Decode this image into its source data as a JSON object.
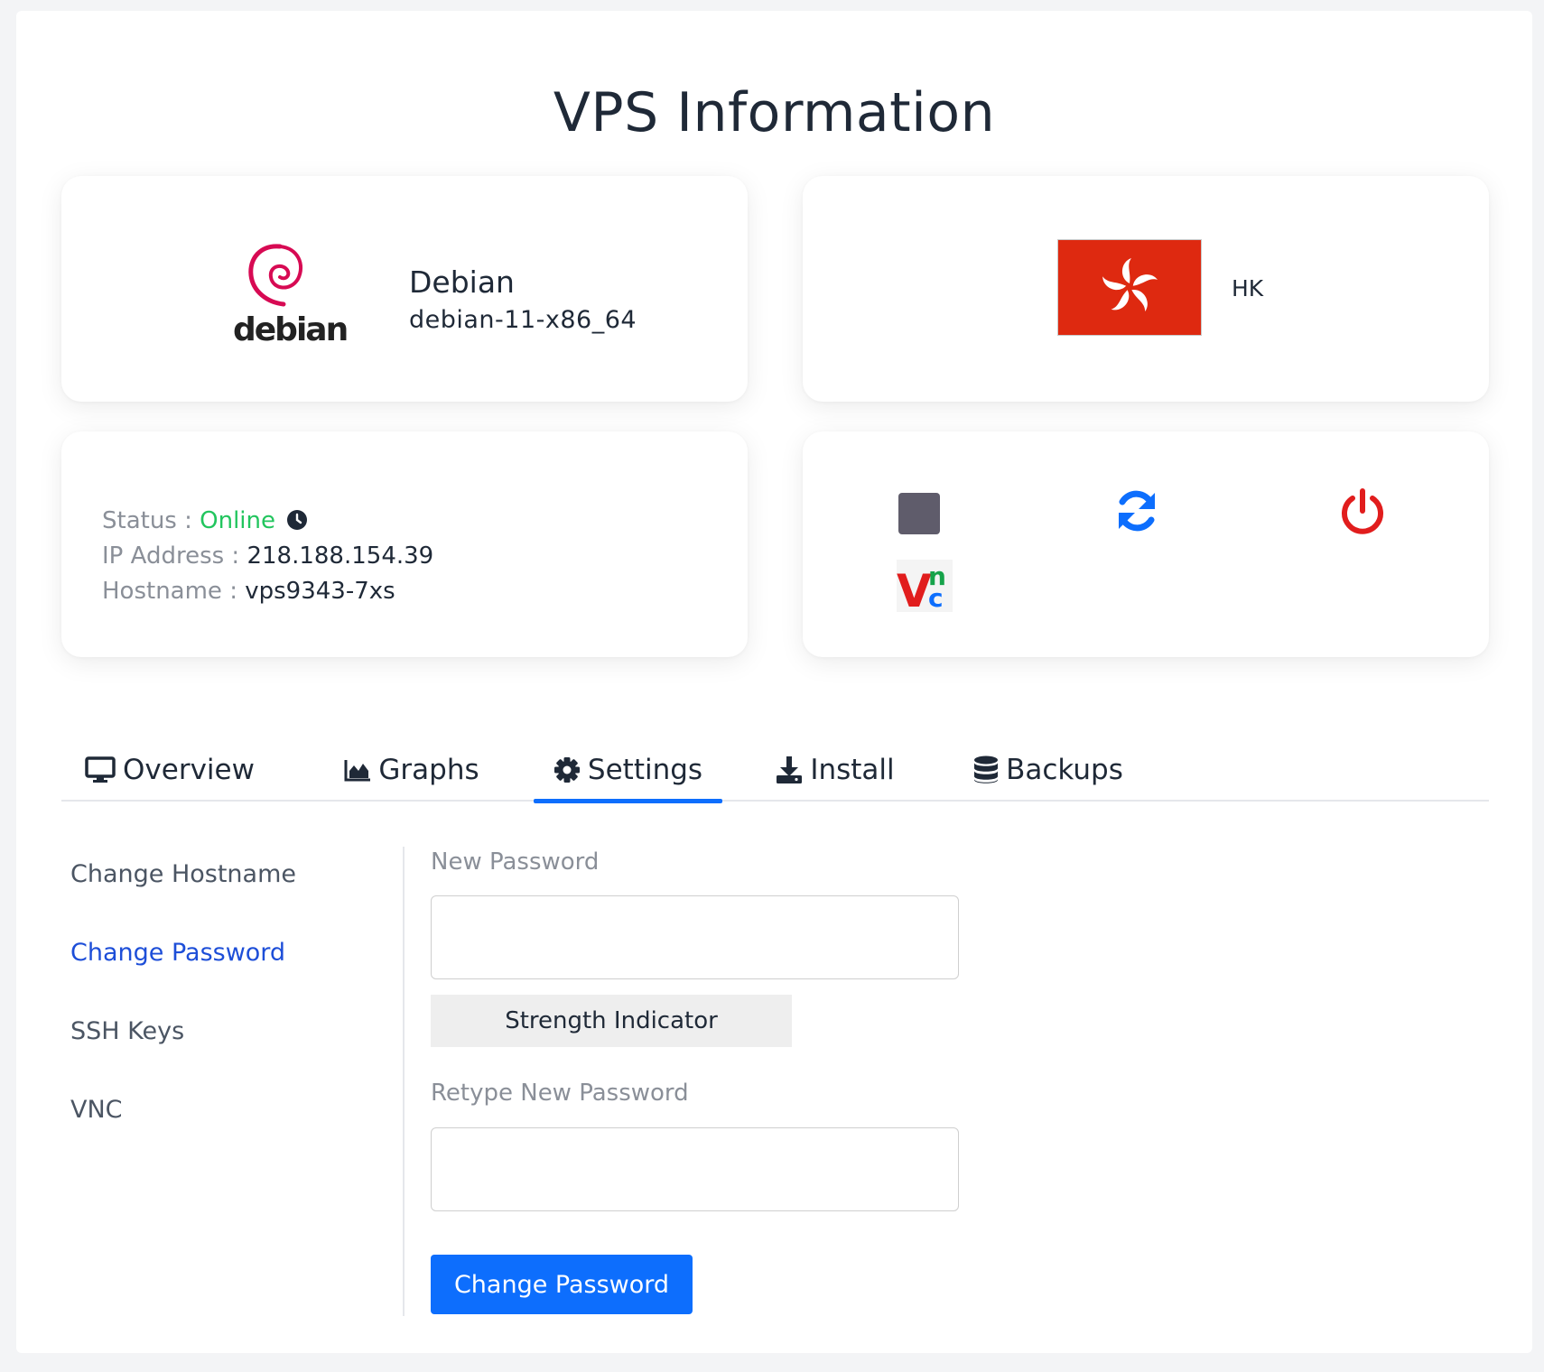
{
  "page": {
    "title": "VPS Information"
  },
  "os": {
    "logo_text": "debian",
    "name": "Debian",
    "version": "debian-11-x86_64",
    "icon": "debian-swirl-logo"
  },
  "location": {
    "code": "HK",
    "flag": "hong-kong-flag",
    "flag_color": "#de2910"
  },
  "info": {
    "status_label": "Status :",
    "status_value": "Online",
    "status_color": "#22c55e",
    "ip_label": "IP Address :",
    "ip_value": "218.188.154.39",
    "hostname_label": "Hostname :",
    "hostname_value": "vps9343-7xs"
  },
  "controls": [
    {
      "name": "stop",
      "icon": "stop-square-icon",
      "color": "#5f5c6b"
    },
    {
      "name": "restart",
      "icon": "sync-icon",
      "color": "#0d6efd"
    },
    {
      "name": "power",
      "icon": "power-icon",
      "color": "#e11d1d"
    },
    {
      "name": "vnc",
      "icon": "vnc-logo-icon"
    }
  ],
  "tabs": [
    {
      "label": "Overview",
      "icon": "desktop-icon",
      "active": false
    },
    {
      "label": "Graphs",
      "icon": "area-chart-icon",
      "active": false
    },
    {
      "label": "Settings",
      "icon": "gear-icon",
      "active": true
    },
    {
      "label": "Install",
      "icon": "download-icon",
      "active": false
    },
    {
      "label": "Backups",
      "icon": "database-icon",
      "active": false
    }
  ],
  "settings_menu": [
    {
      "label": "Change Hostname",
      "active": false
    },
    {
      "label": "Change Password",
      "active": true
    },
    {
      "label": "SSH Keys",
      "active": false
    },
    {
      "label": "VNC",
      "active": false
    }
  ],
  "password_form": {
    "new_password_label": "New Password",
    "new_password_value": "",
    "strength_label": "Strength Indicator",
    "retype_label": "Retype New Password",
    "retype_value": "",
    "submit_label": "Change Password"
  },
  "colors": {
    "accent": "#0d6efd",
    "active_menu": "#1d4ed8"
  }
}
